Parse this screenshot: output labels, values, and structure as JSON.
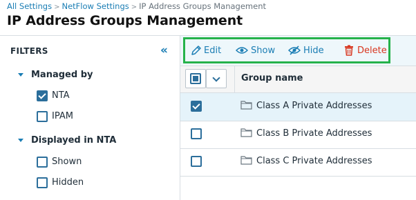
{
  "breadcrumb": {
    "items": [
      {
        "label": "All Settings"
      },
      {
        "label": "NetFlow Settings"
      }
    ],
    "current": "IP Address Groups Management",
    "separator": ">"
  },
  "page": {
    "title": "IP Address Groups Management"
  },
  "filters": {
    "heading": "FILTERS",
    "collapse_icon": "«",
    "groups": [
      {
        "title": "Managed by",
        "options": [
          {
            "label": "NTA",
            "checked": true
          },
          {
            "label": "IPAM",
            "checked": false
          }
        ]
      },
      {
        "title": "Displayed in NTA",
        "options": [
          {
            "label": "Shown",
            "checked": false
          },
          {
            "label": "Hidden",
            "checked": false
          }
        ]
      }
    ]
  },
  "toolbar": {
    "edit_label": "Edit",
    "show_label": "Show",
    "hide_label": "Hide",
    "delete_label": "Delete",
    "icons": {
      "edit": "pencil-icon",
      "show": "eye-icon",
      "hide": "eye-slash-icon",
      "delete": "trash-icon"
    }
  },
  "grid": {
    "columns": [
      {
        "label": "Group name"
      }
    ],
    "select_all_state": "partial",
    "rows": [
      {
        "name": "Class A Private Addresses",
        "checked": true,
        "icon": "folder-icon"
      },
      {
        "name": "Class B Private Addresses",
        "checked": false,
        "icon": "folder-icon"
      },
      {
        "name": "Class C Private Addresses",
        "checked": false,
        "icon": "folder-icon"
      }
    ]
  },
  "colors": {
    "link": "#1a7db4",
    "delete": "#d8361f",
    "highlight_border": "#25b24a",
    "selected_row": "#e5f3fa",
    "toolbar_bg": "#eef7fb"
  }
}
